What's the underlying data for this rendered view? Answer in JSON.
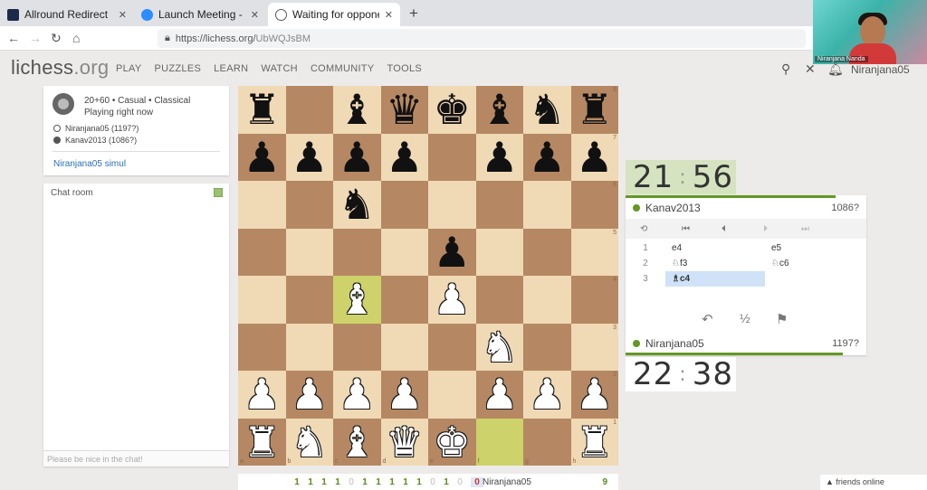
{
  "browser": {
    "tabs": [
      {
        "title": "Allround Redirect",
        "icon_color": "#1e2a4a"
      },
      {
        "title": "Launch Meeting - Zoom",
        "icon_color": "#2d8cff"
      },
      {
        "title": "Waiting for opponent - Play Ka",
        "icon_color": "#ffffff"
      }
    ],
    "url_host": "https://lichess.org/",
    "url_path": "UbWQJsBM"
  },
  "video": {
    "name": "Niranjana Nanda"
  },
  "site": {
    "logo": "lichess",
    "logo_suffix": ".org",
    "nav": [
      "PLAY",
      "PUZZLES",
      "LEARN",
      "WATCH",
      "COMMUNITY",
      "TOOLS"
    ],
    "username": "Niranjana05"
  },
  "game_info": {
    "setup": "20+60 • Casual • Classical",
    "status": "Playing right now",
    "white": "Niranjana05 (1197?)",
    "black": "Kanav2013 (1086?)",
    "simul": "Niranjana05 simul"
  },
  "chat": {
    "title": "Chat room",
    "placeholder": "Please be nice in the chat!"
  },
  "board": {
    "ranks": [
      "8",
      "7",
      "6",
      "5",
      "4",
      "3",
      "2",
      "1"
    ],
    "files": [
      "a",
      "b",
      "c",
      "d",
      "e",
      "f",
      "g",
      "h"
    ],
    "position": [
      [
        "r",
        "",
        "b",
        "q",
        "k",
        "b",
        "n",
        "r"
      ],
      [
        "p",
        "p",
        "p",
        "p",
        "",
        "p",
        "p",
        "p"
      ],
      [
        "",
        "",
        "n",
        "",
        "",
        "",
        "",
        ""
      ],
      [
        "",
        "",
        "",
        "",
        "p",
        "",
        "",
        ""
      ],
      [
        "",
        "",
        "B",
        "",
        "P",
        "",
        "",
        ""
      ],
      [
        "",
        "",
        "",
        "",
        "",
        "N",
        "",
        ""
      ],
      [
        "P",
        "P",
        "P",
        "P",
        "",
        "P",
        "P",
        "P"
      ],
      [
        "R",
        "N",
        "B",
        "Q",
        "K",
        "",
        "",
        "R"
      ]
    ],
    "last_move": [
      "f1",
      "c4"
    ]
  },
  "simul_bar": {
    "results": [
      "1",
      "1",
      "1",
      "1",
      "0",
      "1",
      "1",
      "1",
      "1",
      "1",
      "0",
      "1",
      "0",
      "0"
    ],
    "opponent": "Niranjana05",
    "total": "9"
  },
  "opponent": {
    "name": "Kanav2013",
    "rating": "1086?",
    "clock_min": "21",
    "clock_sec": "56"
  },
  "player": {
    "name": "Niranjana05",
    "rating": "1197?",
    "clock_min": "22",
    "clock_sec": "38"
  },
  "moves": [
    {
      "num": "1",
      "white": "e4",
      "black": "e5"
    },
    {
      "num": "2",
      "white": "♘f3",
      "black": "♘c6"
    },
    {
      "num": "3",
      "white": "♗c4",
      "black": ""
    }
  ],
  "controls": {
    "flip": "⟲",
    "first": "⏮",
    "prev": "⏴",
    "next": "⏵",
    "last": "⏭"
  },
  "actions": {
    "takeback": "↶",
    "draw": "½",
    "resign": "⚑"
  },
  "friends": "▲ friends online"
}
